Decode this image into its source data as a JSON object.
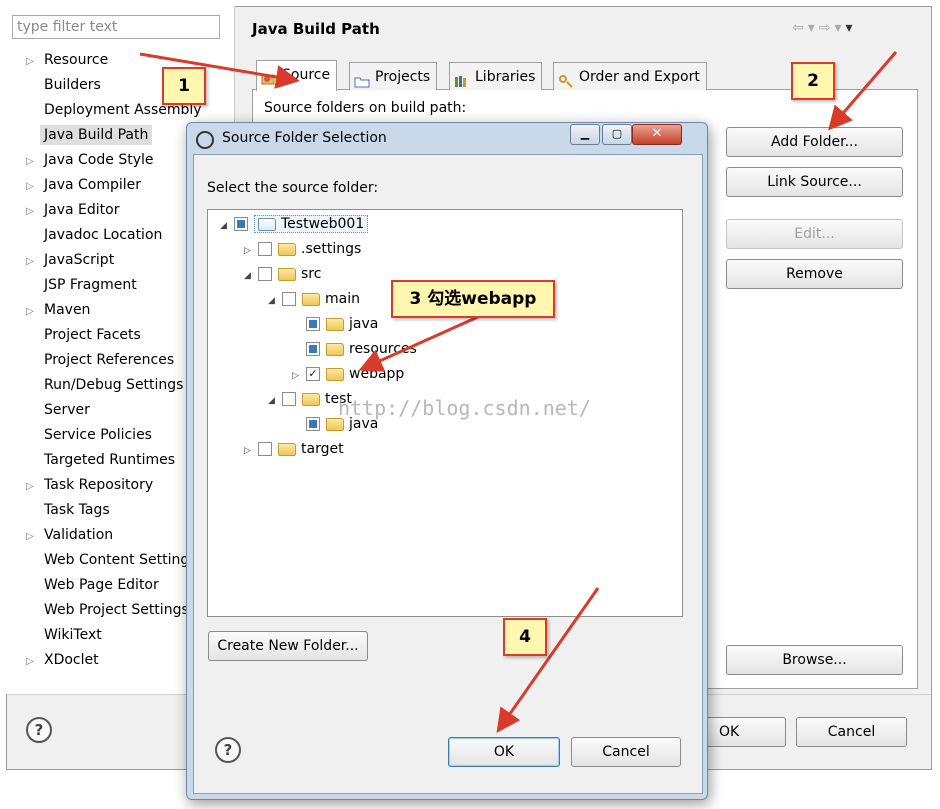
{
  "sidebar": {
    "filter_placeholder": "type filter text",
    "items": [
      {
        "label": "Resource",
        "expandable": true
      },
      {
        "label": "Builders",
        "expandable": false
      },
      {
        "label": "Deployment Assembly",
        "expandable": false
      },
      {
        "label": "Java Build Path",
        "expandable": false,
        "selected": true
      },
      {
        "label": "Java Code Style",
        "expandable": true
      },
      {
        "label": "Java Compiler",
        "expandable": true
      },
      {
        "label": "Java Editor",
        "expandable": true
      },
      {
        "label": "Javadoc Location",
        "expandable": false
      },
      {
        "label": "JavaScript",
        "expandable": true
      },
      {
        "label": "JSP Fragment",
        "expandable": false
      },
      {
        "label": "Maven",
        "expandable": true
      },
      {
        "label": "Project Facets",
        "expandable": false
      },
      {
        "label": "Project References",
        "expandable": false
      },
      {
        "label": "Run/Debug Settings",
        "expandable": false
      },
      {
        "label": "Server",
        "expandable": false
      },
      {
        "label": "Service Policies",
        "expandable": false
      },
      {
        "label": "Targeted Runtimes",
        "expandable": false
      },
      {
        "label": "Task Repository",
        "expandable": true
      },
      {
        "label": "Task Tags",
        "expandable": false
      },
      {
        "label": "Validation",
        "expandable": true
      },
      {
        "label": "Web Content Settings",
        "expandable": false
      },
      {
        "label": "Web Page Editor",
        "expandable": false
      },
      {
        "label": "Web Project Settings",
        "expandable": false
      },
      {
        "label": "WikiText",
        "expandable": false
      },
      {
        "label": "XDoclet",
        "expandable": true
      }
    ]
  },
  "page": {
    "title": "Java Build Path",
    "tabs": [
      "Source",
      "Projects",
      "Libraries",
      "Order and Export"
    ],
    "source_folders_label": "Source folders on build path:",
    "buttons": {
      "add_folder": "Add Folder...",
      "link_source": "Link Source...",
      "edit": "Edit...",
      "remove": "Remove",
      "browse": "Browse..."
    },
    "ok": "OK",
    "cancel": "Cancel"
  },
  "dialog": {
    "title": "Source Folder Selection",
    "prompt": "Select the source folder:",
    "tree": [
      {
        "label": "Testweb001",
        "check": "partial"
      },
      {
        "label": ".settings",
        "check": "none"
      },
      {
        "label": "src",
        "check": "none"
      },
      {
        "label": "main",
        "check": "none"
      },
      {
        "label": "java",
        "check": "partial"
      },
      {
        "label": "resources",
        "check": "partial"
      },
      {
        "label": "webapp",
        "check": "checked"
      },
      {
        "label": "test",
        "check": "none"
      },
      {
        "label": "java",
        "check": "partial"
      },
      {
        "label": "target",
        "check": "none"
      }
    ],
    "create_new_folder": "Create New Folder...",
    "ok": "OK",
    "cancel": "Cancel"
  },
  "annotations": {
    "step1": "1",
    "step2": "2",
    "step3": "3 勾选webapp",
    "step4": "4",
    "arrow_color": "#d93a2a"
  },
  "watermark": "http://blog.csdn.net/",
  "colors": {
    "callout_bg": "#fff6b0",
    "check_partial": "#3a78b8",
    "folder": "#f0c65a"
  }
}
